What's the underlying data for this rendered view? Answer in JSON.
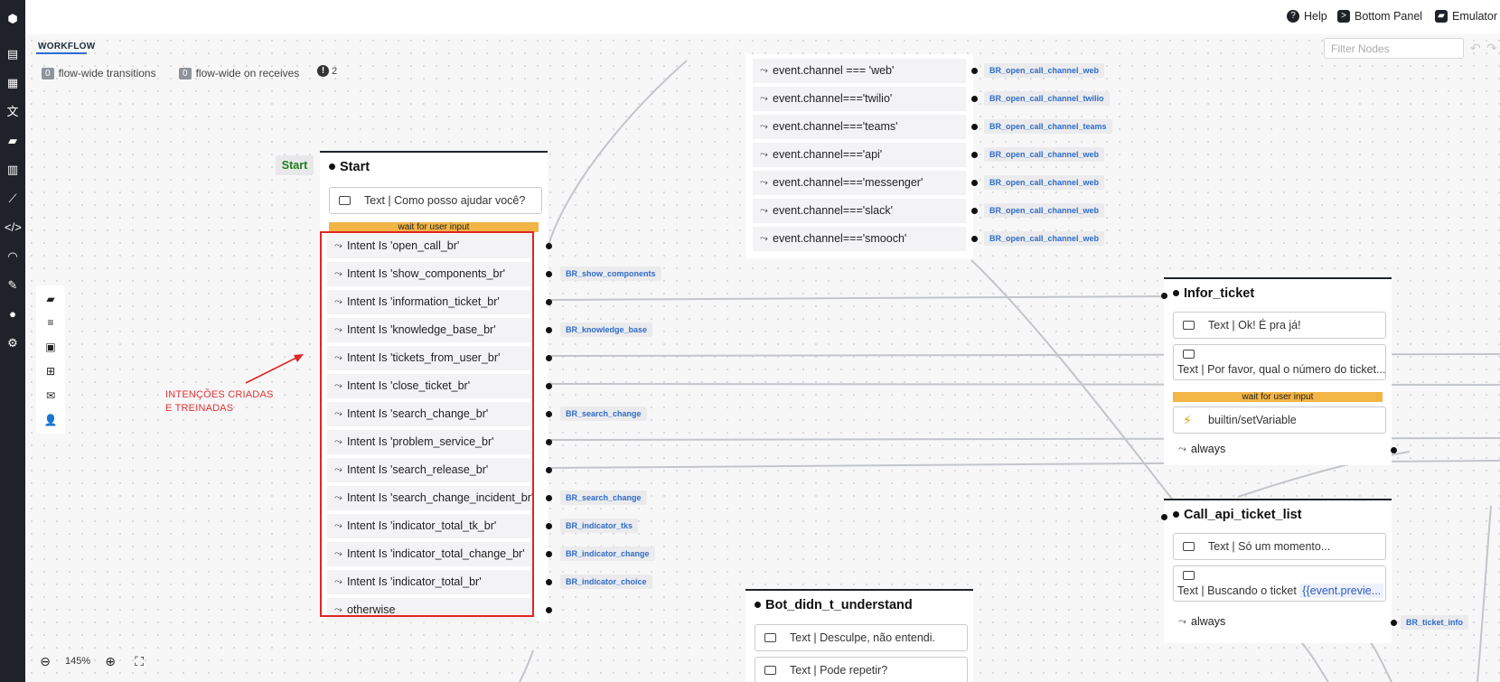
{
  "topbar": {
    "help": "Help",
    "bottom_panel": "Bottom Panel",
    "emulator": "Emulator"
  },
  "workflow": {
    "tab": "WORKFLOW",
    "filter_placeholder": "Filter Nodes",
    "flow_wide_transitions_count": "0",
    "flow_wide_transitions": "flow-wide transitions",
    "flow_wide_receives_count": "0",
    "flow_wide_receives": "flow-wide on receives",
    "warnings": "2",
    "zoom": "145%"
  },
  "start_badge": "Start",
  "annotation": [
    "INTENÇÕES CRIADAS",
    "E TREINADAS"
  ],
  "channel_node": {
    "rows": [
      {
        "cond": "event.channel === 'web'",
        "target": "BR_open_call_channel_web"
      },
      {
        "cond": "event.channel==='twilio'",
        "target": "BR_open_call_channel_twilio"
      },
      {
        "cond": "event.channel==='teams'",
        "target": "BR_open_call_channel_teams"
      },
      {
        "cond": "event.channel==='api'",
        "target": "BR_open_call_channel_web"
      },
      {
        "cond": "event.channel==='messenger'",
        "target": "BR_open_call_channel_web"
      },
      {
        "cond": "event.channel==='slack'",
        "target": "BR_open_call_channel_web"
      },
      {
        "cond": "event.channel==='smooch'",
        "target": "BR_open_call_channel_web"
      }
    ]
  },
  "start_node": {
    "title": "Start",
    "text": "Text | Como posso ajudar você?",
    "wait": "wait for user input",
    "intents": [
      {
        "label": "Intent Is 'open_call_br'",
        "target": ""
      },
      {
        "label": "Intent Is 'show_components_br'",
        "target": "BR_show_components"
      },
      {
        "label": "Intent Is 'information_ticket_br'",
        "target": ""
      },
      {
        "label": "Intent Is 'knowledge_base_br'",
        "target": "BR_knowledge_base"
      },
      {
        "label": "Intent Is 'tickets_from_user_br'",
        "target": ""
      },
      {
        "label": "Intent Is 'close_ticket_br'",
        "target": ""
      },
      {
        "label": "Intent Is 'search_change_br'",
        "target": "BR_search_change"
      },
      {
        "label": "Intent Is 'problem_service_br'",
        "target": ""
      },
      {
        "label": "Intent Is 'search_release_br'",
        "target": ""
      },
      {
        "label": "Intent Is 'search_change_incident_br'",
        "target": "BR_search_change"
      },
      {
        "label": "Intent Is 'indicator_total_tk_br'",
        "target": "BR_indicator_tks"
      },
      {
        "label": "Intent Is 'indicator_total_change_br'",
        "target": "BR_indicator_change"
      },
      {
        "label": "Intent Is 'indicator_total_br'",
        "target": "BR_indicator_choice"
      },
      {
        "label": "otherwise",
        "target": ""
      }
    ]
  },
  "infor_node": {
    "title": "Infor_ticket",
    "text1": "Text | Ok! É pra já!",
    "text2": "Text | Por favor, qual o número do ticket...",
    "wait": "wait for user input",
    "action": "builtin/setVariable",
    "always": "always"
  },
  "call_api_node": {
    "title": "Call_api_ticket_list",
    "text1": "Text | Só um momento...",
    "text2": "Text | Buscando o ticket",
    "var": "{{event.previe...",
    "always": "always",
    "target": "BR_ticket_info"
  },
  "bot_node": {
    "title": "Bot_didn_t_understand",
    "text1": "Text | Desculpe, não entendi.",
    "text2": "Text | Pode repetir?"
  }
}
